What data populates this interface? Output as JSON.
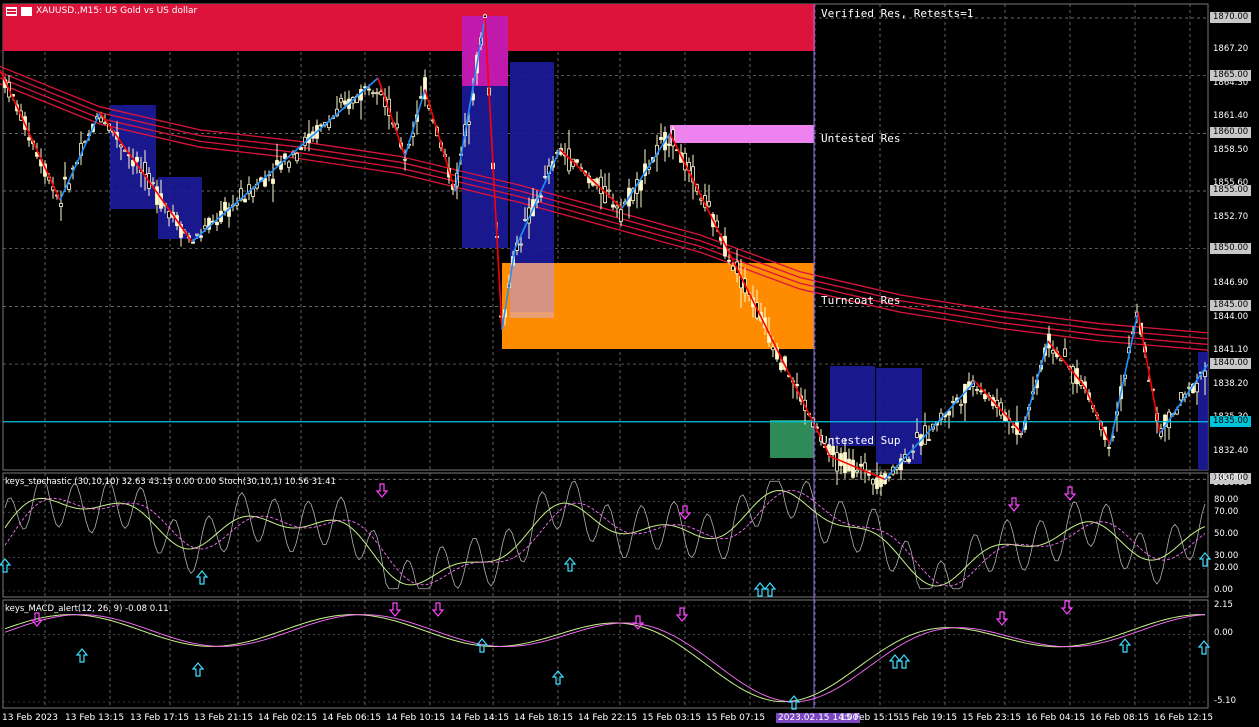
{
  "window": {
    "title": "XAUUSD.,M15:  US Gold vs US dollar"
  },
  "price_axis": {
    "labels": [
      "1870.00",
      "1867.20",
      "1864.30",
      "1861.40",
      "1858.50",
      "1855.60",
      "1852.70",
      "1849.80",
      "1846.90",
      "1844.00",
      "1841.10",
      "1838.20",
      "1835.30",
      "1832.40",
      "1829.60"
    ],
    "tagged": [
      "1870.00",
      "1865.00",
      "1860.00",
      "1855.00",
      "1850.00",
      "1845.00",
      "1840.00",
      "1830.00"
    ],
    "current": "1835.00"
  },
  "zones": {
    "verified": "Verified Res, Retests=1",
    "untested_res": "Untested Res",
    "turncoat": "Turncoat Res",
    "untested_sup": "Untested Sup"
  },
  "stoch": {
    "title": "keys_stochastic (30,10,10) 32.63 43.15 0.00 0.00 Stoch(30,10,1) 10.56 31.41",
    "levels": [
      "100.00",
      "80.00",
      "70.00",
      "50.00",
      "30.00",
      "20.00",
      "0.00"
    ]
  },
  "macd": {
    "title": "keys_MACD_alert(12, 26, 9) -0.08 0.11",
    "levels": [
      "2.15",
      "0.00",
      "-5.10"
    ]
  },
  "time_axis": {
    "labels": [
      "13 Feb 2023",
      "13 Feb 13:15",
      "13 Feb 17:15",
      "13 Feb 21:15",
      "14 Feb 02:15",
      "14 Feb 06:15",
      "14 Feb 10:15",
      "14 Feb 14:15",
      "14 Feb 18:15",
      "14 Feb 22:15",
      "15 Feb 03:15",
      "15 Feb 07:15",
      "2023.02.15 14:00",
      "15 Feb 15:15",
      "15 Feb 19:15",
      "15 Feb 23:15",
      "16 Feb 04:15",
      "16 Feb 08:15",
      "16 Feb 12:15"
    ]
  },
  "colors": {
    "background": "#000000",
    "candle": "#fffacd",
    "zigzag_up": "#1e90ff",
    "zigzag_down": "#ff0000",
    "ma": "#dc143c",
    "current_price": "#00c2d8",
    "verified_zone": "#dc143c",
    "turncoat_zone": "#ff8c00",
    "untested_res_zone": "#ee82ee",
    "untested_sup_zone": "#2e8b57",
    "range_box": "#1c1c9c"
  },
  "chart_data": [
    {
      "type": "candlestick",
      "symbol": "XAUUSD.",
      "timeframe": "M15",
      "ylim": [
        1829.6,
        1870.0
      ],
      "zigzag": [
        [
          0,
          1865.5
        ],
        [
          60,
          1854.2
        ],
        [
          100,
          1861.8
        ],
        [
          192,
          1850.6
        ],
        [
          378,
          1864.8
        ],
        [
          405,
          1858.0
        ],
        [
          425,
          1863.8
        ],
        [
          455,
          1855.0
        ],
        [
          485,
          1870.0
        ],
        [
          502,
          1843.0
        ],
        [
          515,
          1850.0
        ],
        [
          560,
          1858.6
        ],
        [
          622,
          1853.5
        ],
        [
          670,
          1860.0
        ],
        [
          830,
          1832.0
        ],
        [
          885,
          1830.0
        ],
        [
          975,
          1838.5
        ],
        [
          1022,
          1834.0
        ],
        [
          1048,
          1842.0
        ],
        [
          1085,
          1838.0
        ],
        [
          1110,
          1833.0
        ],
        [
          1138,
          1844.5
        ],
        [
          1160,
          1834.0
        ],
        [
          1208,
          1840.0
        ]
      ],
      "ma_bands": [
        [
          1865.8,
          1862.3,
          1860.3,
          1859.3,
          1858.0,
          1855.5,
          1851.2,
          1848.0,
          1846.0,
          1844.6,
          1843.5,
          1842.7
        ],
        [
          1865.3,
          1861.8,
          1859.8,
          1858.8,
          1857.5,
          1855.0,
          1850.7,
          1847.5,
          1845.5,
          1844.1,
          1843.0,
          1842.2
        ],
        [
          1864.8,
          1861.3,
          1859.3,
          1858.3,
          1857.0,
          1854.5,
          1850.2,
          1847.0,
          1845.0,
          1843.6,
          1842.5,
          1841.7
        ],
        [
          1864.3,
          1860.8,
          1858.8,
          1857.8,
          1856.5,
          1854.0,
          1849.7,
          1846.5,
          1844.5,
          1843.1,
          1842.0,
          1841.2
        ]
      ],
      "current_price": 1835.0
    },
    {
      "type": "line",
      "name": "keys_stochastic",
      "ylim": [
        0,
        100
      ],
      "values": {
        "main": 32.63,
        "signal": 43.15,
        "stoch_main": 10.56,
        "stoch_signal": 31.41
      }
    },
    {
      "type": "line",
      "name": "keys_MACD_alert",
      "ylim": [
        -5.1,
        2.15
      ],
      "values": {
        "macd": -0.08,
        "signal": 0.11
      }
    }
  ]
}
